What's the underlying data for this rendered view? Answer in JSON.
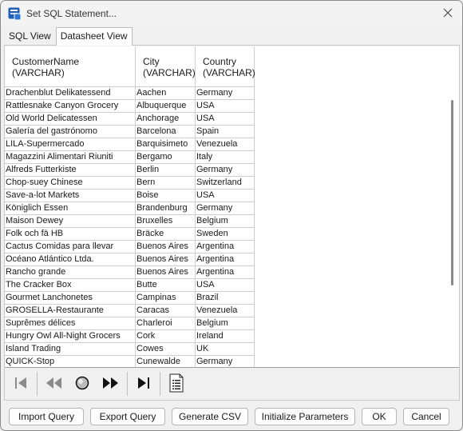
{
  "window": {
    "title": "Set SQL Statement...",
    "colors": {
      "icon_blue": "#1f5fb5",
      "accent": "#0067c0"
    }
  },
  "tabs": [
    {
      "label": "SQL View",
      "active": false
    },
    {
      "label": "Datasheet View",
      "active": true
    }
  ],
  "grid": {
    "columns": [
      {
        "name": "CustomerName",
        "type": "(VARCHAR)"
      },
      {
        "name": "City",
        "type": "(VARCHAR)"
      },
      {
        "name": "Country",
        "type": "(VARCHAR)"
      }
    ],
    "rows": [
      [
        "Drachenblut Delikatessend",
        "Aachen",
        "Germany"
      ],
      [
        "Rattlesnake Canyon Grocery",
        "Albuquerque",
        "USA"
      ],
      [
        "Old World Delicatessen",
        "Anchorage",
        "USA"
      ],
      [
        "Galería del gastrónomo",
        "Barcelona",
        "Spain"
      ],
      [
        "LILA-Supermercado",
        "Barquisimeto",
        "Venezuela"
      ],
      [
        "Magazzini Alimentari Riuniti",
        "Bergamo",
        "Italy"
      ],
      [
        "Alfreds Futterkiste",
        "Berlin",
        "Germany"
      ],
      [
        "Chop-suey Chinese",
        "Bern",
        "Switzerland"
      ],
      [
        "Save-a-lot Markets",
        "Boise",
        "USA"
      ],
      [
        "Königlich Essen",
        "Brandenburg",
        "Germany"
      ],
      [
        "Maison Dewey",
        "Bruxelles",
        "Belgium"
      ],
      [
        "Folk och fä HB",
        "Bräcke",
        "Sweden"
      ],
      [
        "Cactus Comidas para llevar",
        "Buenos Aires",
        "Argentina"
      ],
      [
        "Océano Atlántico Ltda.",
        "Buenos Aires",
        "Argentina"
      ],
      [
        "Rancho grande",
        "Buenos Aires",
        "Argentina"
      ],
      [
        "The Cracker Box",
        "Butte",
        "USA"
      ],
      [
        "Gourmet Lanchonetes",
        "Campinas",
        "Brazil"
      ],
      [
        "GROSELLA-Restaurante",
        "Caracas",
        "Venezuela"
      ],
      [
        "Suprêmes délices",
        "Charleroi",
        "Belgium"
      ],
      [
        "Hungry Owl All-Night Grocers",
        "Cork",
        "Ireland"
      ],
      [
        "Island Trading",
        "Cowes",
        "UK"
      ],
      [
        "QUICK-Stop",
        "Cunewalde",
        "Germany"
      ]
    ]
  },
  "navigation": [
    {
      "name": "first-record-icon"
    },
    {
      "name": "previous-page-icon"
    },
    {
      "name": "stop-icon"
    },
    {
      "name": "next-page-icon"
    },
    {
      "name": "last-record-icon"
    },
    {
      "name": "document-list-icon"
    }
  ],
  "buttons": {
    "import_query": "Import Query",
    "export_query": "Export Query",
    "generate_csv": "Generate CSV",
    "initialize_parameters": "Initialize Parameters",
    "ok": "OK",
    "cancel": "Cancel"
  }
}
